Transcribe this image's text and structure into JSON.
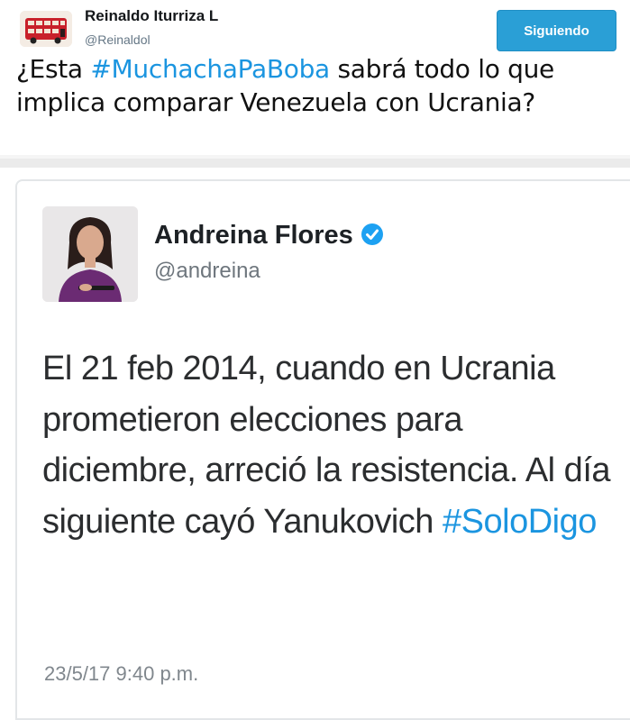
{
  "tweet": {
    "author_name": "Reinaldo Iturriza L",
    "author_handle": "@Reinaldol",
    "follow_label": "Siguiendo",
    "text_before": "¿Esta ",
    "hashtag": "#MuchachaPaBoba",
    "text_after": " sabrá todo lo que implica comparar Venezuela con Ucrania?"
  },
  "quoted": {
    "author_name": "Andreina Flores",
    "author_handle": "@andreina",
    "text_before": "El 21 feb 2014, cuando en Ucrania prometieron elecciones para diciembre, arreció la resistencia. Al día siguiente cayó Yanukovich ",
    "hashtag": "#SoloDigo",
    "timestamp": "23/5/17 9:40 p.m."
  },
  "icons": {
    "top_avatar": "red-double-decker-bus-avatar",
    "quoted_avatar": "woman-with-microphone-avatar",
    "verified": "verified-badge-icon"
  },
  "colors": {
    "accent": "#1b95e0",
    "follow_button": "#2a9fd6"
  }
}
